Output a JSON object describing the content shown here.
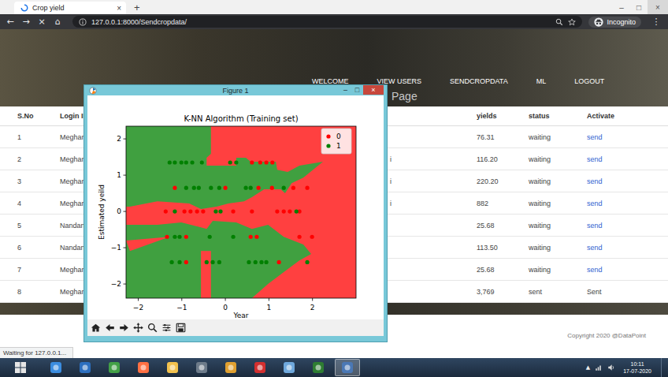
{
  "browser": {
    "tab": {
      "title": "Crop yield",
      "close": "×",
      "selected": true
    },
    "new_tab": "+",
    "window_controls": [
      "–",
      "□",
      "×"
    ],
    "nav_buttons": [
      "←",
      "→",
      "×",
      "⌂"
    ],
    "url": "127.0.0.1:8000/Sendcropdata/",
    "profile": "Incognito",
    "menu": "⋮"
  },
  "site": {
    "nav": [
      {
        "label": "WELCOME"
      },
      {
        "label": "VIEW USERS"
      },
      {
        "label": "SENDCROPDATA"
      },
      {
        "label": "ML"
      },
      {
        "label": "LOGOUT"
      }
    ],
    "heading": "Page",
    "footer": "Copyright 2020 @DataPoint"
  },
  "table": {
    "columns": [
      "S.No",
      "Login ID",
      "",
      "yields",
      "status",
      "Activate"
    ],
    "rows": [
      {
        "sno": "1",
        "login": "Meghana",
        "crop": "",
        "yields": "76.31",
        "status": "waiting",
        "action": "send",
        "kind": "link"
      },
      {
        "sno": "2",
        "login": "Meghana",
        "crop": "i",
        "yields": "116.20",
        "status": "waiting",
        "action": "send",
        "kind": "link"
      },
      {
        "sno": "3",
        "login": "Meghana",
        "crop": "i",
        "yields": "220.20",
        "status": "waiting",
        "action": "send",
        "kind": "link"
      },
      {
        "sno": "4",
        "login": "Meghana",
        "crop": "i",
        "yields": "882",
        "status": "waiting",
        "action": "send",
        "kind": "link"
      },
      {
        "sno": "5",
        "login": "Nandana",
        "crop": "",
        "yields": "25.68",
        "status": "waiting",
        "action": "send",
        "kind": "link"
      },
      {
        "sno": "6",
        "login": "Nandana",
        "crop": "",
        "yields": "113.50",
        "status": "waiting",
        "action": "send",
        "kind": "link"
      },
      {
        "sno": "7",
        "login": "Meghana",
        "crop": "",
        "yields": "25.68",
        "status": "waiting",
        "action": "send",
        "kind": "link"
      },
      {
        "sno": "8",
        "login": "Meghana",
        "crop": "",
        "yields": "3,769",
        "status": "sent",
        "action": "Sent",
        "kind": "text"
      }
    ]
  },
  "status_bar": "Waiting for 127.0.0.1...",
  "figure": {
    "title": "Figure 1",
    "controls": [
      "–",
      "□",
      "×"
    ],
    "chart": {
      "title": "K-NN Algorithm (Training set)",
      "x_label": "Year",
      "y_label": "Estimated yeild",
      "x_ticks": [
        "−2",
        "−1",
        "0",
        "1",
        "2"
      ],
      "y_ticks": [
        "−2",
        "−1",
        "0",
        "1",
        "2"
      ],
      "series": [
        {
          "label": "0",
          "color": "#ff0000",
          "points": [
            [
              0.61,
              1.35
            ],
            [
              0.8,
              1.35
            ],
            [
              0.94,
              1.35
            ],
            [
              1.08,
              1.35
            ],
            [
              -1.16,
              0.65
            ],
            [
              0.0,
              0.65
            ],
            [
              0.76,
              0.65
            ],
            [
              1.07,
              0.65
            ],
            [
              1.56,
              0.65
            ],
            [
              1.88,
              0.65
            ],
            [
              -1.37,
              0
            ],
            [
              -0.94,
              0
            ],
            [
              -0.8,
              0
            ],
            [
              -0.65,
              0
            ],
            [
              -0.51,
              0
            ],
            [
              0.18,
              0
            ],
            [
              0.61,
              0
            ],
            [
              1.19,
              0
            ],
            [
              1.34,
              0
            ],
            [
              1.48,
              0
            ],
            [
              1.7,
              0
            ],
            [
              -1.34,
              -0.7
            ],
            [
              -0.9,
              -0.7
            ],
            [
              0.58,
              -0.7
            ],
            [
              0.72,
              -0.7
            ],
            [
              1.7,
              -0.7
            ],
            [
              1.99,
              -0.7
            ],
            [
              -0.9,
              -1.4
            ],
            [
              1.23,
              -1.4
            ]
          ]
        },
        {
          "label": "1",
          "color": "#008000",
          "points": [
            [
              -1.28,
              1.35
            ],
            [
              -1.16,
              1.35
            ],
            [
              -1.01,
              1.35
            ],
            [
              -0.9,
              1.35
            ],
            [
              -0.76,
              1.35
            ],
            [
              -0.54,
              1.35
            ],
            [
              0.11,
              1.35
            ],
            [
              0.25,
              1.35
            ],
            [
              -0.9,
              0.65
            ],
            [
              -0.72,
              0.65
            ],
            [
              -0.61,
              0.65
            ],
            [
              -0.33,
              0.65
            ],
            [
              -0.14,
              0.65
            ],
            [
              0.47,
              0.65
            ],
            [
              0.58,
              0.65
            ],
            [
              1.34,
              0.65
            ],
            [
              -1.16,
              0
            ],
            [
              -0.22,
              0
            ],
            [
              -0.11,
              0
            ],
            [
              1.63,
              0
            ],
            [
              -1.16,
              -0.7
            ],
            [
              -1.05,
              -0.7
            ],
            [
              -0.36,
              -0.7
            ],
            [
              0.18,
              -0.7
            ],
            [
              -1.23,
              -1.4
            ],
            [
              -1.05,
              -1.4
            ],
            [
              -0.43,
              -1.4
            ],
            [
              -0.29,
              -1.4
            ],
            [
              -0.14,
              -1.4
            ],
            [
              0.54,
              -1.4
            ],
            [
              0.69,
              -1.4
            ],
            [
              0.83,
              -1.4
            ],
            [
              0.94,
              -1.4
            ],
            [
              1.88,
              -1.4
            ]
          ]
        }
      ],
      "regions": [
        {
          "class": "0",
          "polygon": [
            [
              -2.28,
              2.35
            ],
            [
              3.0,
              2.35
            ],
            [
              3.0,
              -2.39
            ],
            [
              -2.28,
              -2.39
            ]
          ]
        },
        {
          "class": "1",
          "polygon": [
            [
              -2.28,
              2.35
            ],
            [
              -0.33,
              2.35
            ],
            [
              -0.33,
              1.59
            ],
            [
              -0.43,
              1.48
            ],
            [
              -0.43,
              1.26
            ],
            [
              0.25,
              1.26
            ],
            [
              0.25,
              1.48
            ],
            [
              0.47,
              1.48
            ],
            [
              0.58,
              1.37
            ],
            [
              1.16,
              1.37
            ],
            [
              1.19,
              1.15
            ],
            [
              1.43,
              1.09
            ],
            [
              1.7,
              1.26
            ],
            [
              2.24,
              1.37
            ],
            [
              1.79,
              0.93
            ],
            [
              1.52,
              0.78
            ],
            [
              1.37,
              0.5
            ],
            [
              1.27,
              0.61
            ],
            [
              0.89,
              0.61
            ],
            [
              0.61,
              0.39
            ],
            [
              0.43,
              0.28
            ],
            [
              0.07,
              0.22
            ],
            [
              -0.2,
              0.13
            ],
            [
              -0.56,
              0.07
            ],
            [
              -0.83,
              0.22
            ],
            [
              -1.56,
              0.28
            ],
            [
              -2.19,
              0.13
            ],
            [
              -2.28,
              0.13
            ]
          ]
        },
        {
          "class": "1",
          "polygon": [
            [
              -2.28,
              -0.37
            ],
            [
              -1.56,
              -0.37
            ],
            [
              -1.01,
              -0.3
            ],
            [
              -0.43,
              -0.48
            ],
            [
              -0.29,
              -0.26
            ],
            [
              0.25,
              -0.3
            ],
            [
              0.61,
              -0.48
            ],
            [
              0.98,
              -0.37
            ],
            [
              1.34,
              -0.7
            ],
            [
              1.79,
              -0.91
            ],
            [
              1.97,
              -1.17
            ],
            [
              1.7,
              -1.35
            ],
            [
              1.34,
              -1.67
            ],
            [
              0.98,
              -2.0
            ],
            [
              0.61,
              -2.39
            ],
            [
              -2.28,
              -2.39
            ]
          ]
        },
        {
          "class": "0",
          "polygon": [
            [
              -0.56,
              -1.09
            ],
            [
              -0.33,
              -1.09
            ],
            [
              -0.33,
              -2.39
            ],
            [
              -0.56,
              -2.39
            ]
          ]
        },
        {
          "class": "0",
          "polygon": [
            [
              -2.28,
              -0.8
            ],
            [
              -1.28,
              -0.7
            ],
            [
              -2.19,
              -1.09
            ]
          ]
        }
      ]
    }
  },
  "taskbar": {
    "apps": [
      {
        "selected": false
      },
      {
        "selected": false
      },
      {
        "selected": false
      },
      {
        "selected": false
      },
      {
        "selected": false
      },
      {
        "selected": false
      },
      {
        "selected": false
      },
      {
        "selected": false
      },
      {
        "selected": false
      },
      {
        "selected": false
      },
      {
        "selected": true
      }
    ],
    "tray": "▲",
    "time": "10:11",
    "date": "17-07-2020"
  }
}
